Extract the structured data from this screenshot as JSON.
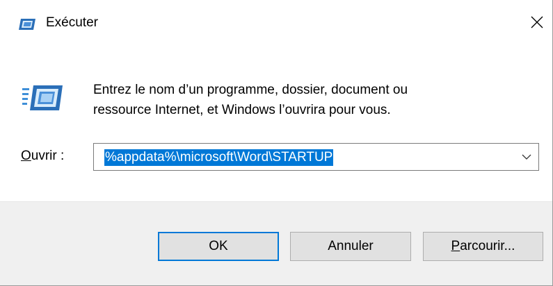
{
  "window": {
    "title": "Exécuter",
    "title_icon": "run-icon",
    "close_icon": "close-icon"
  },
  "content": {
    "description_line1": "Entrez le nom d’un programme, dossier, document ou",
    "description_line2": "ressource Internet, et Windows l’ouvrira pour vous.",
    "open_label_accel": "O",
    "open_label_rest": "uvrir :",
    "open_value": "%appdata%\\microsoft\\Word\\STARTUP",
    "dropdown_icon": "chevron-down-icon"
  },
  "buttons": {
    "ok_label": "OK",
    "cancel_label": "Annuler",
    "browse_accel": "P",
    "browse_rest": "arcourir..."
  },
  "colors": {
    "selection": "#0078d7",
    "footer_bg": "#f0f0f0",
    "button_bg": "#e1e1e1"
  }
}
